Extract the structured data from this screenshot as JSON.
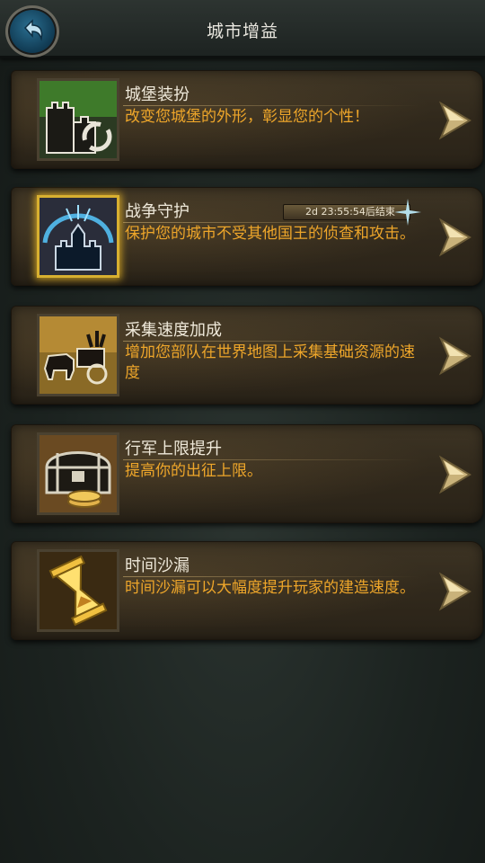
{
  "header": {
    "title": "城市增益",
    "back_icon": "back-arrow-icon"
  },
  "items": [
    {
      "name": "城堡装扮",
      "desc": "改变您城堡的外形，彰显您的个性！",
      "icon": "castle-skin-icon"
    },
    {
      "name": "战争守护",
      "desc": "保护您的城市不受其他国王的侦查和攻击。",
      "icon": "war-shield-icon",
      "timer": "2d 23:55:54后结束",
      "active": true
    },
    {
      "name": "采集速度加成",
      "desc": "增加您部队在世界地图上采集基础资源的速度",
      "icon": "ox-cart-icon"
    },
    {
      "name": "行军上限提升",
      "desc": "提高你的出征上限。",
      "icon": "treasure-chest-icon"
    },
    {
      "name": "时间沙漏",
      "desc": "时间沙漏可以大幅度提升玩家的建造速度。",
      "icon": "hourglass-icon"
    }
  ],
  "colors": {
    "accent_text": "#eea62a",
    "title_text": "#efe9da"
  }
}
